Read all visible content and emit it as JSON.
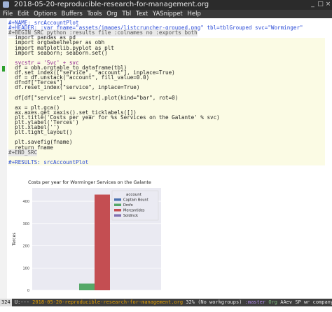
{
  "window": {
    "title": "2018-05-20-reproducible-research-for-management.org"
  },
  "menubar": {
    "items": [
      "File",
      "Edit",
      "Options",
      "Buffers",
      "Tools",
      "Org",
      "Tbl",
      "Text",
      "YASnippet",
      "Help"
    ]
  },
  "editor": {
    "lines": [
      {
        "text": "#+NAME: srcAccountPlot",
        "cls": "kw-blue"
      },
      {
        "text": "#+HEADER: :var fname=\"assets/images/listcruncher-grouped.png\" tbl=tblGrouped svc=\"Worminger\"",
        "cls": "kw-blue"
      },
      {
        "text": "#+BEGIN_SRC python :results file :colnames no :exports both",
        "cls": "kw-begin"
      },
      {
        "text": "  import pandas as pd",
        "cls": ""
      },
      {
        "text": "  import orgbabelhelper as obh",
        "cls": ""
      },
      {
        "text": "  import matplotlib.pyplot as plt",
        "cls": ""
      },
      {
        "text": "  import seaborn; seaborn.set()",
        "cls": ""
      },
      {
        "text": "",
        "cls": ""
      },
      {
        "text": "  svcstr = 'Svc' + svc",
        "cls": "kw-str"
      },
      {
        "text": "  df = obh.orgtable_to_dataframe(tbl)",
        "cls": ""
      },
      {
        "text": "  df.set_index([\"service\", \"account\"], inplace=True)",
        "cls": ""
      },
      {
        "text": "  df = df.unstack(\"account\", fill_value=0.0)",
        "cls": ""
      },
      {
        "text": "  df=df[\"Terces\"]",
        "cls": ""
      },
      {
        "text": "  df.reset_index(\"service\", inplace=True)",
        "cls": ""
      },
      {
        "text": "",
        "cls": ""
      },
      {
        "text": "  df[df[\"service\"] == svcstr].plot(kind=\"bar\", rot=0)",
        "cls": ""
      },
      {
        "text": "",
        "cls": ""
      },
      {
        "text": "  ax = plt.gca()",
        "cls": ""
      },
      {
        "text": "  ax.axes.get_xaxis().set_ticklabels([])",
        "cls": ""
      },
      {
        "text": "  plt.title('Costs per year for %s Services on the Galante' % svc)",
        "cls": ""
      },
      {
        "text": "  plt.ylabel('Terces')",
        "cls": ""
      },
      {
        "text": "  plt.xlabel('')",
        "cls": ""
      },
      {
        "text": "  plt.tight_layout()",
        "cls": ""
      },
      {
        "text": "",
        "cls": ""
      },
      {
        "text": "  plt.savefig(fname)",
        "cls": ""
      },
      {
        "text": "  return fname",
        "cls": ""
      },
      {
        "text": "#+END_SRC",
        "cls": "kw-begin"
      },
      {
        "text": "",
        "cls": ""
      },
      {
        "text": "#+RESULTS: srcAccountPlot",
        "cls": "kw-blue"
      }
    ]
  },
  "chart_data": {
    "type": "bar",
    "title": "Costs per year for Worminger Services on the Galante",
    "ylabel": "Terces",
    "xlabel": "",
    "ylim": [
      0,
      460
    ],
    "yticks": [
      0,
      100,
      200,
      300,
      400
    ],
    "legend_title": "account",
    "legend_position": "top-right",
    "series": [
      {
        "name": "Captain Bount",
        "color": "#4c72b0",
        "value": 0
      },
      {
        "name": "Drofo",
        "color": "#55a868",
        "value": 30
      },
      {
        "name": "Mercantides",
        "color": "#c44e52",
        "value": 430
      },
      {
        "name": "Soldinck",
        "color": "#8172b2",
        "value": 0
      }
    ]
  },
  "modeline": {
    "line_no": "324",
    "status": "U:---",
    "buffer": "2018-05-20-reproducible-research-for-management.org",
    "percent": "32%",
    "project": "(No workgroups)",
    "branch": ":master",
    "mode": "Org",
    "minor": "AAev SP wr company"
  }
}
